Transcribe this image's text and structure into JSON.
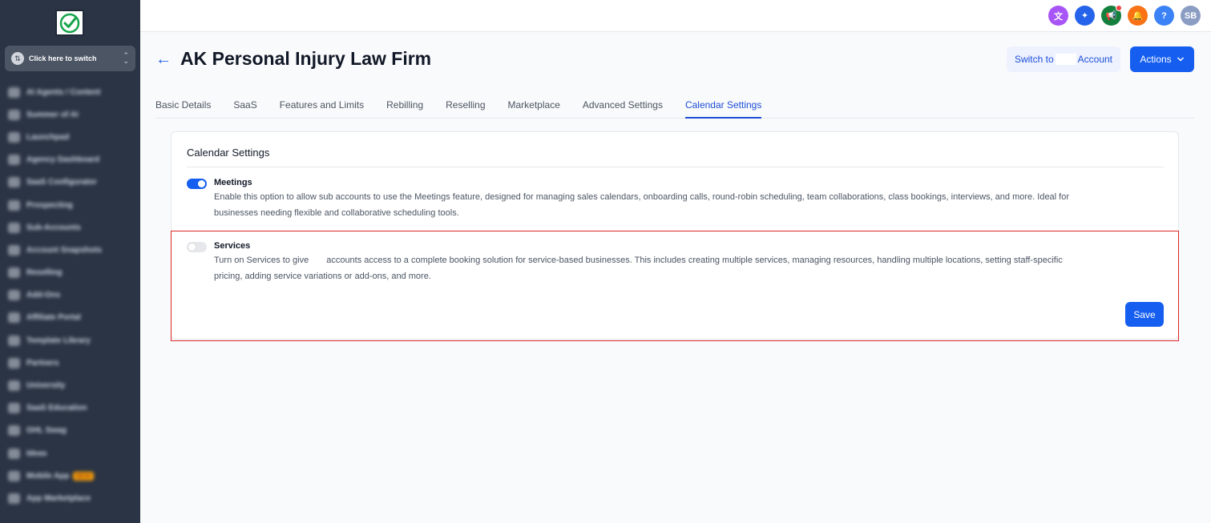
{
  "sidebar": {
    "switcher_label": "Click here to switch",
    "items": [
      {
        "label": "AI Agents / Content"
      },
      {
        "label": "Summer of AI"
      },
      {
        "label": "Launchpad"
      },
      {
        "label": "Agency Dashboard"
      },
      {
        "label": "SaaS Configurator"
      },
      {
        "label": "Prospecting"
      },
      {
        "label": "Sub-Accounts"
      },
      {
        "label": "Account Snapshots"
      },
      {
        "label": "Reselling"
      },
      {
        "label": "Add-Ons"
      },
      {
        "label": "Affiliate Portal"
      },
      {
        "label": "Template Library"
      },
      {
        "label": "Partners"
      },
      {
        "label": "University"
      },
      {
        "label": "SaaS Education"
      },
      {
        "label": "GHL Swag"
      },
      {
        "label": "Ideas"
      },
      {
        "label": "Mobile App",
        "badge": "NEW"
      },
      {
        "label": "App Marketplace"
      }
    ]
  },
  "topbar": {
    "icons": [
      {
        "name": "translate-icon",
        "glyph": "文",
        "color": "#a855f7"
      },
      {
        "name": "ai-sparkle-icon",
        "glyph": "✦",
        "color": "#2563eb"
      },
      {
        "name": "megaphone-icon",
        "glyph": "📢",
        "color": "#15803d"
      },
      {
        "name": "bell-icon",
        "glyph": "🔔",
        "color": "#f97316"
      },
      {
        "name": "help-icon",
        "glyph": "?",
        "color": "#3b82f6"
      }
    ],
    "avatar": "SB",
    "avatar_color": "#8b9dc3"
  },
  "header": {
    "title": "AK Personal Injury Law Firm",
    "switch_prefix": "Switch to",
    "switch_suffix": "Account",
    "actions_label": "Actions"
  },
  "tabs": [
    {
      "label": "Basic Details",
      "active": false
    },
    {
      "label": "SaaS",
      "active": false
    },
    {
      "label": "Features and Limits",
      "active": false
    },
    {
      "label": "Rebilling",
      "active": false
    },
    {
      "label": "Reselling",
      "active": false
    },
    {
      "label": "Marketplace",
      "active": false
    },
    {
      "label": "Advanced Settings",
      "active": false
    },
    {
      "label": "Calendar Settings",
      "active": true
    }
  ],
  "card": {
    "title": "Calendar Settings",
    "meetings": {
      "label": "Meetings",
      "enabled": true,
      "desc_line1": "Enable this option to allow sub accounts to use the Meetings feature, designed for managing sales calendars, onboarding calls, round-robin scheduling, team collaborations, class bookings, interviews, and more. Ideal for",
      "desc_line2": "businesses needing flexible and collaborative scheduling tools."
    },
    "services": {
      "label": "Services",
      "enabled": false,
      "desc_line1_a": "Turn on Services to give",
      "desc_line1_b": "accounts access to a complete booking solution for service-based businesses. This includes creating multiple services, managing resources, handling multiple locations, setting staff-specific",
      "desc_line2": "pricing, adding service variations or add-ons, and more."
    },
    "save_label": "Save"
  },
  "colors": {
    "accent": "#155eef",
    "sidebar_bg": "#2b3444",
    "highlight": "#dc2626"
  }
}
